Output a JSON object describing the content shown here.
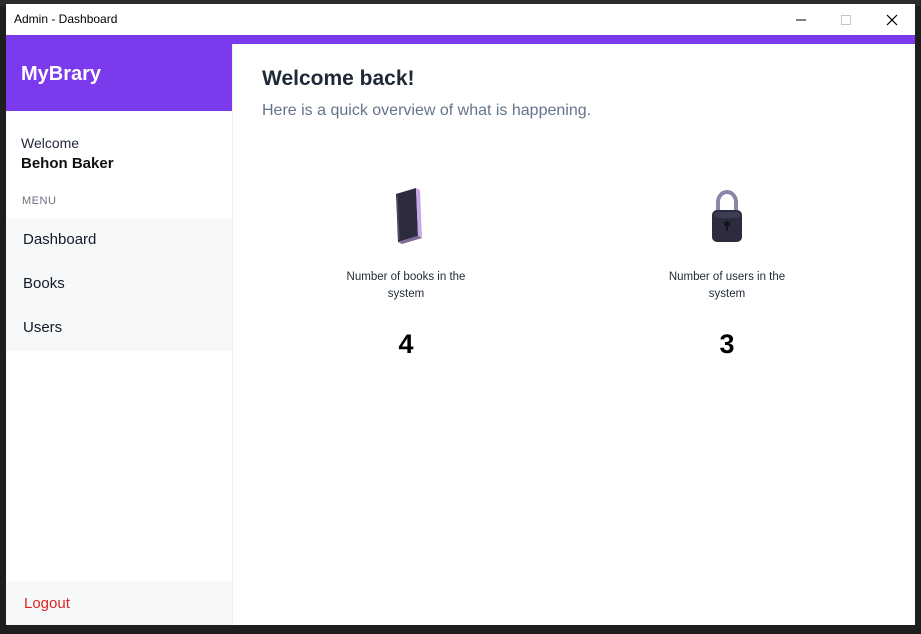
{
  "window": {
    "title": "Admin - Dashboard",
    "controls": [
      "minimize-icon",
      "maximize-icon",
      "close-icon"
    ]
  },
  "colors": {
    "accent": "#7c3aed",
    "sidebar_menu_bg": "#f7f8fa",
    "logout": "#dc2626",
    "subtitle": "#64748b"
  },
  "sidebar": {
    "brand": "MyBrary",
    "welcome_label": "Welcome",
    "user_name": "Behon Baker",
    "menu_header": "MENU",
    "items": [
      {
        "label": "Dashboard"
      },
      {
        "label": "Books"
      },
      {
        "label": "Users"
      }
    ],
    "logout_label": "Logout"
  },
  "main": {
    "title": "Welcome back!",
    "subtitle": "Here is a quick overview of what is happening.",
    "stats": [
      {
        "icon": "book-icon",
        "label": "Number of books in the system",
        "value": "4"
      },
      {
        "icon": "padlock-icon",
        "label": "Number of users in the system",
        "value": "3"
      }
    ]
  }
}
